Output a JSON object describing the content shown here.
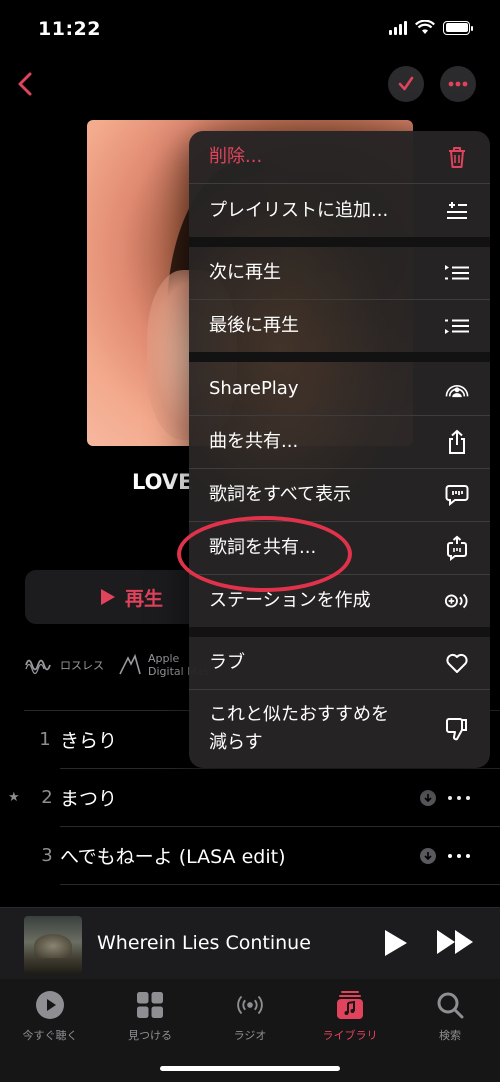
{
  "status": {
    "time": "11:22"
  },
  "album": {
    "title": "LOVE"
  },
  "actions": {
    "play_label": "再生"
  },
  "badges": {
    "lossless": "ロスレス",
    "adm_line1": "Apple",
    "adm_line2": "Digital Mas"
  },
  "tracks": [
    {
      "num": "1",
      "title": "きらり",
      "starred": false
    },
    {
      "num": "2",
      "title": "まつり",
      "starred": true
    },
    {
      "num": "3",
      "title": "へでもねーよ (LASA edit)",
      "starred": false
    }
  ],
  "menu": {
    "items": [
      {
        "label": "削除...",
        "icon": "trash-icon",
        "color": "#e0435b"
      },
      {
        "label": "プレイリストに追加...",
        "icon": "add-to-playlist-icon"
      },
      {
        "label": "次に再生",
        "icon": "play-next-icon"
      },
      {
        "label": "最後に再生",
        "icon": "play-last-icon"
      },
      {
        "label": "SharePlay",
        "icon": "shareplay-icon"
      },
      {
        "label": "曲を共有...",
        "icon": "share-icon"
      },
      {
        "label": "歌詞をすべて表示",
        "icon": "lyrics-icon"
      },
      {
        "label": "歌詞を共有...",
        "icon": "share-lyrics-icon"
      },
      {
        "label": "ステーションを作成",
        "icon": "station-icon"
      },
      {
        "label": "ラブ",
        "icon": "heart-icon"
      },
      {
        "label": "これと似たおすすめを減らす",
        "label_line1": "これと似たおすすめを",
        "label_line2": "減らす",
        "icon": "thumbs-down-icon"
      }
    ]
  },
  "mini_player": {
    "title": "Wherein Lies Continue"
  },
  "tabs": [
    {
      "label": "今すぐ聴く",
      "icon": "play-circle-icon"
    },
    {
      "label": "見つける",
      "icon": "grid-icon"
    },
    {
      "label": "ラジオ",
      "icon": "radio-icon"
    },
    {
      "label": "ライブラリ",
      "icon": "library-icon",
      "active": true
    },
    {
      "label": "検索",
      "icon": "search-icon"
    }
  ],
  "colors": {
    "accent": "#e0435b",
    "background": "#000000",
    "menu": "#262424",
    "annotation": "#e0334b"
  }
}
